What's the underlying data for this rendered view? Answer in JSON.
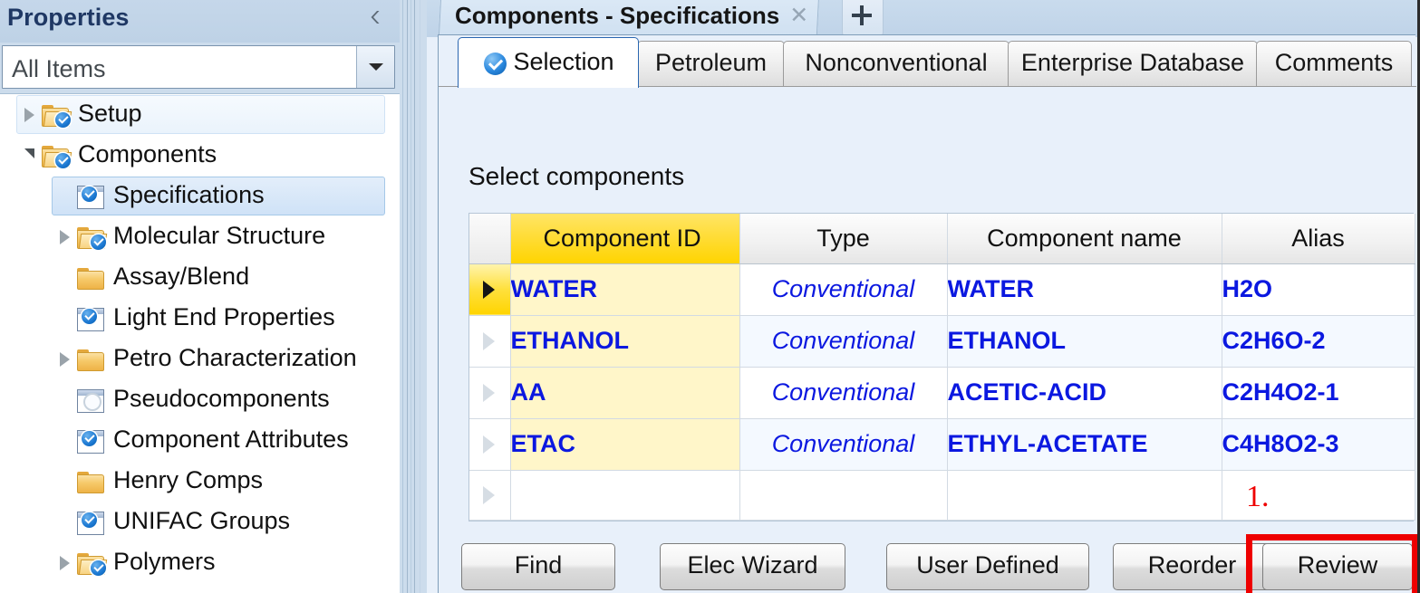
{
  "sidebar": {
    "title": "Properties",
    "collapse_icon": "chevron-left-icon",
    "filter": {
      "value": "All Items",
      "dropdown_icon": "caret-down-icon"
    },
    "tree": [
      {
        "label": "Setup",
        "indent": 0,
        "expander": "collapsed",
        "icon": "folder-check-icon",
        "state": "hover"
      },
      {
        "label": "Components",
        "indent": 0,
        "expander": "expanded",
        "icon": "folder-check-icon",
        "state": "none"
      },
      {
        "label": "Specifications",
        "indent": 1,
        "expander": "none",
        "icon": "window-check-icon",
        "state": "selected"
      },
      {
        "label": "Molecular Structure",
        "indent": 1,
        "expander": "collapsed",
        "icon": "folder-check-icon",
        "state": "none"
      },
      {
        "label": "Assay/Blend",
        "indent": 1,
        "expander": "none",
        "icon": "folder-icon",
        "state": "none"
      },
      {
        "label": "Light End Properties",
        "indent": 1,
        "expander": "none",
        "icon": "window-check-icon",
        "state": "none"
      },
      {
        "label": "Petro Characterization",
        "indent": 1,
        "expander": "collapsed",
        "icon": "folder-icon",
        "state": "none"
      },
      {
        "label": "Pseudocomponents",
        "indent": 1,
        "expander": "none",
        "icon": "window-circle-icon",
        "state": "none"
      },
      {
        "label": "Component Attributes",
        "indent": 1,
        "expander": "none",
        "icon": "window-check-icon",
        "state": "none"
      },
      {
        "label": "Henry Comps",
        "indent": 1,
        "expander": "none",
        "icon": "folder-icon",
        "state": "none"
      },
      {
        "label": "UNIFAC Groups",
        "indent": 1,
        "expander": "none",
        "icon": "window-check-icon",
        "state": "none"
      },
      {
        "label": "Polymers",
        "indent": 1,
        "expander": "collapsed",
        "icon": "folder-check-icon",
        "state": "none"
      }
    ]
  },
  "document_tab": {
    "title": "Components - Specifications",
    "close_label": "✕",
    "new_tab_icon": "plus-icon"
  },
  "property_tabs": [
    {
      "label": "Selection",
      "active": true,
      "icon": "blue-check-icon"
    },
    {
      "label": "Petroleum",
      "active": false,
      "icon": ""
    },
    {
      "label": "Nonconventional",
      "active": false,
      "icon": ""
    },
    {
      "label": "Enterprise Database",
      "active": false,
      "icon": ""
    },
    {
      "label": "Comments",
      "active": false,
      "icon": ""
    }
  ],
  "content": {
    "section_label": "Select components",
    "annotation": "1."
  },
  "grid": {
    "columns": [
      "Component ID",
      "Type",
      "Component name",
      "Alias"
    ],
    "rows": [
      {
        "id": "WATER",
        "type": "Conventional",
        "name": "WATER",
        "alias": "H2O",
        "current": true
      },
      {
        "id": "ETHANOL",
        "type": "Conventional",
        "name": "ETHANOL",
        "alias": "C2H6O-2",
        "current": false
      },
      {
        "id": "AA",
        "type": "Conventional",
        "name": "ACETIC-ACID",
        "alias": "C2H4O2-1",
        "current": false
      },
      {
        "id": "ETAC",
        "type": "Conventional",
        "name": "ETHYL-ACETATE",
        "alias": "C4H8O2-3",
        "current": false
      },
      {
        "id": "",
        "type": "",
        "name": "",
        "alias": "",
        "current": false
      }
    ]
  },
  "buttons": [
    {
      "label": "Find",
      "highlighted": false
    },
    {
      "label": "Elec Wizard",
      "highlighted": false
    },
    {
      "label": "User Defined",
      "highlighted": false
    },
    {
      "label": "Reorder",
      "highlighted": false
    },
    {
      "label": "Review",
      "highlighted": true
    }
  ],
  "colors": {
    "accent_blue": "#1b78d2",
    "key_yellow": "#ffd400",
    "cell_text_blue": "#0b18e0",
    "annotation_red": "#ee0000",
    "sidebar_bg": "#ccdcec",
    "pane_bg": "#e8f0fa"
  }
}
